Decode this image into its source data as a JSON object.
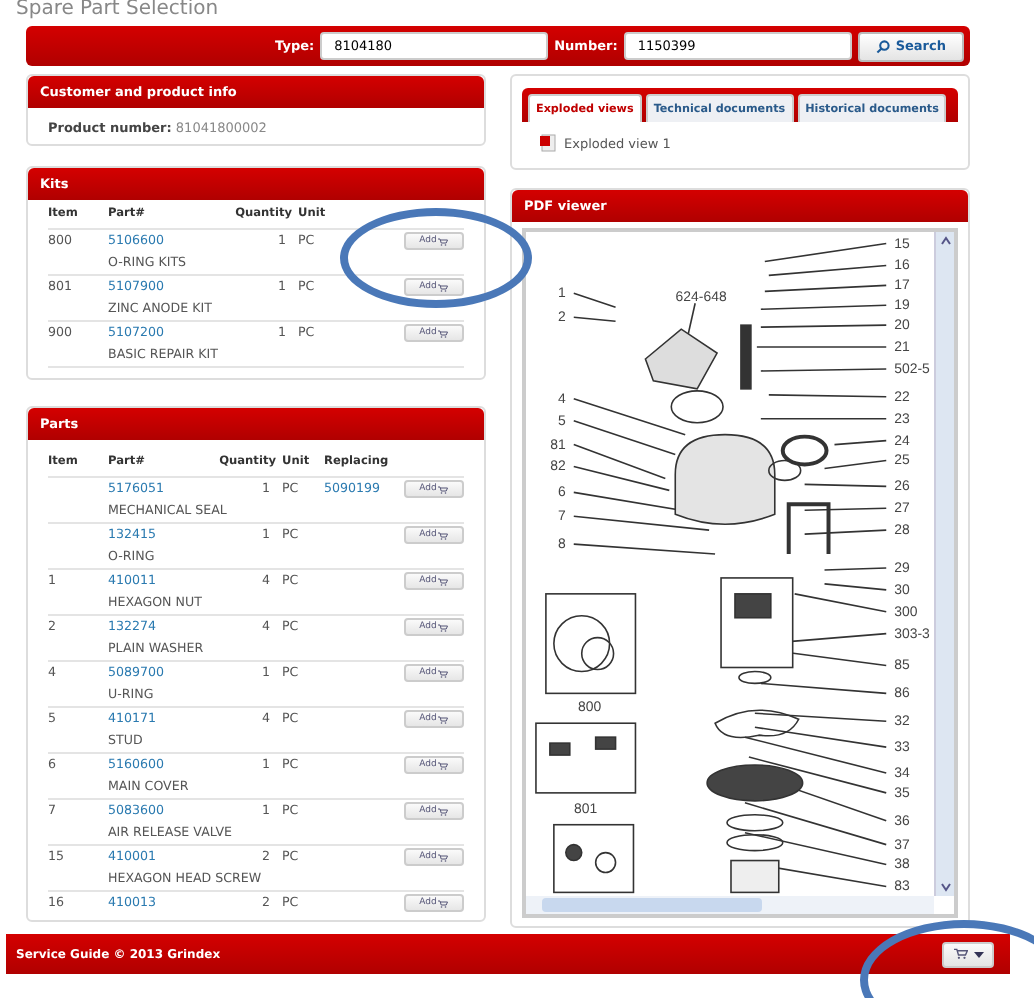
{
  "page_title": "Spare Part Selection",
  "search": {
    "type_label": "Type:",
    "type_value": "8104180",
    "number_label": "Number:",
    "number_value": "1150399",
    "button": "Search"
  },
  "customer_panel": {
    "title": "Customer and product info",
    "product_label": "Product number:",
    "product_number": "81041800002"
  },
  "kits": {
    "title": "Kits",
    "columns": [
      "Item",
      "Part#",
      "Quantity",
      "Unit"
    ],
    "rows": [
      {
        "item": "800",
        "part": "5106600",
        "description": "O-RING KITS",
        "quantity": "1",
        "unit": "PC",
        "button": "Add"
      },
      {
        "item": "801",
        "part": "5107900",
        "description": "ZINC ANODE KIT",
        "quantity": "1",
        "unit": "PC",
        "button": "Add"
      },
      {
        "item": "900",
        "part": "5107200",
        "description": "BASIC REPAIR KIT",
        "quantity": "1",
        "unit": "PC",
        "button": "Add"
      }
    ]
  },
  "parts": {
    "title": "Parts",
    "columns": [
      "Item",
      "Part#",
      "Quantity",
      "Unit",
      "Replacing"
    ],
    "rows": [
      {
        "item": "",
        "part": "5176051",
        "description": "MECHANICAL SEAL",
        "quantity": "1",
        "unit": "PC",
        "replacing": "5090199",
        "button": "Add"
      },
      {
        "item": "",
        "part": "132415",
        "description": "O-RING",
        "quantity": "1",
        "unit": "PC",
        "replacing": "",
        "button": "Add"
      },
      {
        "item": "1",
        "part": "410011",
        "description": "HEXAGON NUT",
        "quantity": "4",
        "unit": "PC",
        "replacing": "",
        "button": "Add"
      },
      {
        "item": "2",
        "part": "132274",
        "description": "PLAIN WASHER",
        "quantity": "4",
        "unit": "PC",
        "replacing": "",
        "button": "Add"
      },
      {
        "item": "4",
        "part": "5089700",
        "description": "U-RING",
        "quantity": "1",
        "unit": "PC",
        "replacing": "",
        "button": "Add"
      },
      {
        "item": "5",
        "part": "410171",
        "description": "STUD",
        "quantity": "4",
        "unit": "PC",
        "replacing": "",
        "button": "Add"
      },
      {
        "item": "6",
        "part": "5160600",
        "description": "MAIN COVER",
        "quantity": "1",
        "unit": "PC",
        "replacing": "",
        "button": "Add"
      },
      {
        "item": "7",
        "part": "5083600",
        "description": "AIR RELEASE VALVE",
        "quantity": "1",
        "unit": "PC",
        "replacing": "",
        "button": "Add"
      },
      {
        "item": "15",
        "part": "410001",
        "description": "HEXAGON HEAD SCREW",
        "quantity": "2",
        "unit": "PC",
        "replacing": "",
        "button": "Add"
      },
      {
        "item": "16",
        "part": "410013",
        "description": "",
        "quantity": "2",
        "unit": "PC",
        "replacing": "",
        "button": "Add"
      }
    ]
  },
  "documents": {
    "tabs": [
      {
        "label": "Exploded views",
        "selected": true
      },
      {
        "label": "Technical documents",
        "selected": false
      },
      {
        "label": "Historical documents",
        "selected": false
      }
    ],
    "files": [
      "Exploded view 1"
    ]
  },
  "pdf_viewer": {
    "title": "PDF viewer",
    "top_callout": "624-648",
    "left_callouts": [
      "1",
      "2",
      "4",
      "5",
      "81",
      "82",
      "6",
      "7",
      "8"
    ],
    "right_callouts": [
      "15",
      "16",
      "17",
      "19",
      "20",
      "21",
      "502-5",
      "22",
      "23",
      "24",
      "25",
      "26",
      "27",
      "28",
      "29",
      "30",
      "300",
      "303-3",
      "85",
      "86",
      "32",
      "33",
      "34",
      "35",
      "36",
      "37",
      "38",
      "83"
    ],
    "kit_labels": [
      "800",
      "801"
    ]
  },
  "footer": {
    "text": "Service Guide © 2013 Grindex"
  }
}
